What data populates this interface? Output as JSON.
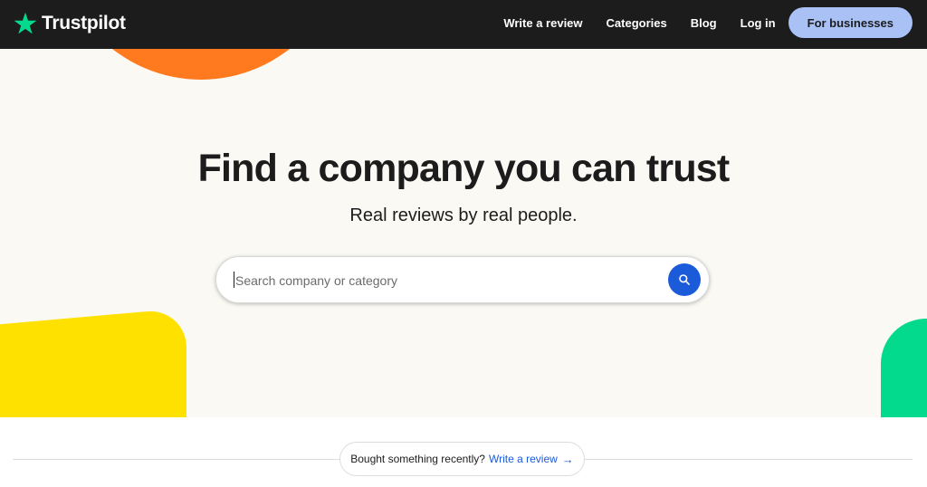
{
  "header": {
    "logo_text": "Trustpilot",
    "logo_icon": "star-icon",
    "nav": [
      {
        "label": "Write a review"
      },
      {
        "label": "Categories"
      },
      {
        "label": "Blog"
      },
      {
        "label": "Log in"
      }
    ],
    "cta_label": "For businesses"
  },
  "hero": {
    "title": "Find a company you can trust",
    "subtitle": "Real reviews by real people.",
    "search": {
      "placeholder": "Search company or category",
      "value": "",
      "button_icon": "search-icon"
    }
  },
  "footer_prompt": {
    "text": "Bought something recently?",
    "link_label": "Write a review",
    "arrow": "→"
  },
  "colors": {
    "nav_bg": "#1c1c1c",
    "brand_star": "#04da8d",
    "cta_bg": "#a9c1f5",
    "hero_bg": "#fbf9f3",
    "accent_blue": "#1b5ad8",
    "orange": "#ff7a1f",
    "yellow": "#ffe100",
    "green": "#04da8d"
  }
}
